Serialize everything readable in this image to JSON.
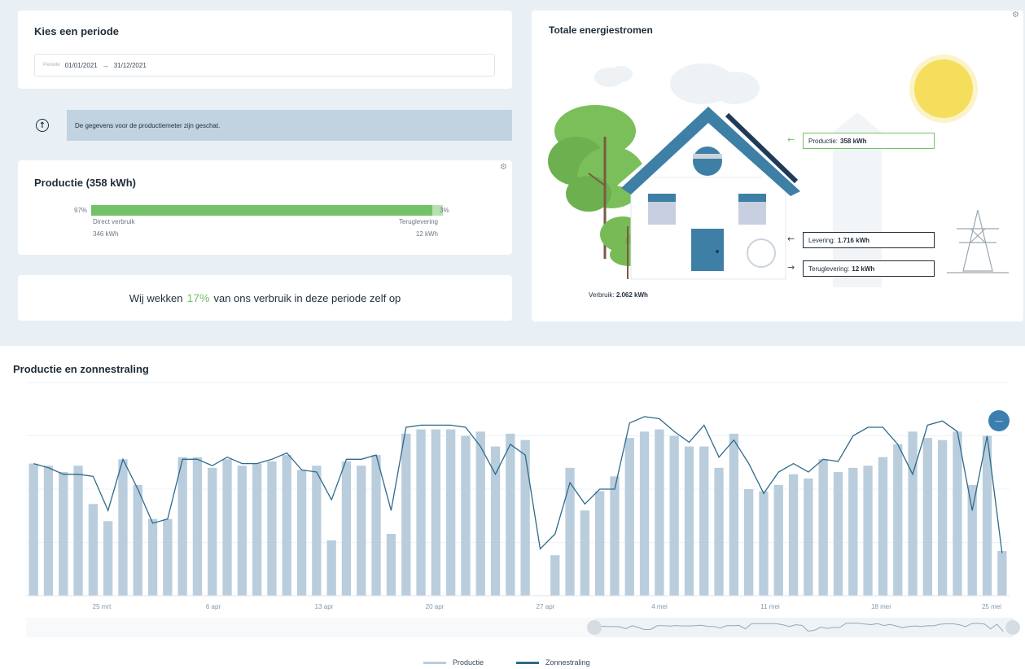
{
  "period": {
    "title": "Kies een periode",
    "field_label": "Periode",
    "start": "01/01/2021",
    "separator": "→",
    "end": "31/12/2021"
  },
  "info": {
    "icon": "info-icon",
    "text": "De gegevens voor de productiemeter zijn geschat."
  },
  "production": {
    "title": "Productie (358 kWh)",
    "left_pct": "97%",
    "right_pct": "3%",
    "share_direct": 0.97,
    "left_label": "Direct verbruik",
    "left_value": "346 kWh",
    "right_label": "Teruglevering",
    "right_value": "12 kWh"
  },
  "self_sufficiency": {
    "prefix": "Wij wekken",
    "percent": "17%",
    "suffix": "van ons verbruik in deze periode zelf op"
  },
  "energy_flows": {
    "title": "Totale energiestromen",
    "productie_label": "Productie:",
    "productie_value": "358 kWh",
    "levering_label": "Levering:",
    "levering_value": "1.716 kWh",
    "teruglevering_label": "Teruglevering:",
    "teruglevering_value": "12 kWh",
    "verbruik_label": "Verbruik:",
    "verbruik_value": "2.062 kWh"
  },
  "colors": {
    "bar": "#b9cddd",
    "line": "#2f6a8b",
    "green": "#73c267",
    "accent": "#3b7fb0"
  },
  "chart_title": "Productie en zonnestraling",
  "chart_data": {
    "type": "bar",
    "x_tick_labels": [
      "25 mrt",
      "6 apr",
      "13 apr",
      "20 apr",
      "27 apr",
      "4 mei",
      "11 mei",
      "18 mei",
      "25 mei"
    ],
    "series": [
      {
        "name": "Productie",
        "type": "bar",
        "values": [
          62,
          61,
          58,
          61,
          43,
          35,
          64,
          52,
          36,
          36,
          65,
          65,
          60,
          64,
          61,
          62,
          63,
          66,
          59,
          61,
          26,
          63,
          61,
          66,
          29,
          76,
          78,
          78,
          78,
          75,
          77,
          70,
          76,
          73,
          0,
          19,
          60,
          40,
          49,
          56,
          74,
          77,
          78,
          75,
          70,
          70,
          60,
          76,
          50,
          49,
          52,
          57,
          55,
          64,
          58,
          60,
          61,
          65,
          71,
          77,
          74,
          73,
          77,
          52,
          75,
          21
        ]
      },
      {
        "name": "Zonnestraling",
        "type": "line",
        "values": [
          62,
          60,
          57,
          57,
          56,
          40,
          64,
          50,
          34,
          36,
          64,
          64,
          61,
          65,
          62,
          62,
          64,
          67,
          59,
          58,
          45,
          64,
          64,
          66,
          40,
          79,
          80,
          80,
          80,
          79,
          70,
          57,
          71,
          66,
          22,
          29,
          53,
          43,
          50,
          50,
          81,
          84,
          83,
          77,
          72,
          80,
          65,
          73,
          62,
          48,
          58,
          62,
          58,
          64,
          63,
          75,
          79,
          79,
          71,
          57,
          80,
          82,
          77,
          40,
          75,
          20
        ]
      }
    ],
    "ylim": [
      0,
      100
    ],
    "legend": "bottom-center"
  },
  "zoom_button": "—",
  "legend_entries": [
    "Productie",
    "Zonnestraling"
  ]
}
